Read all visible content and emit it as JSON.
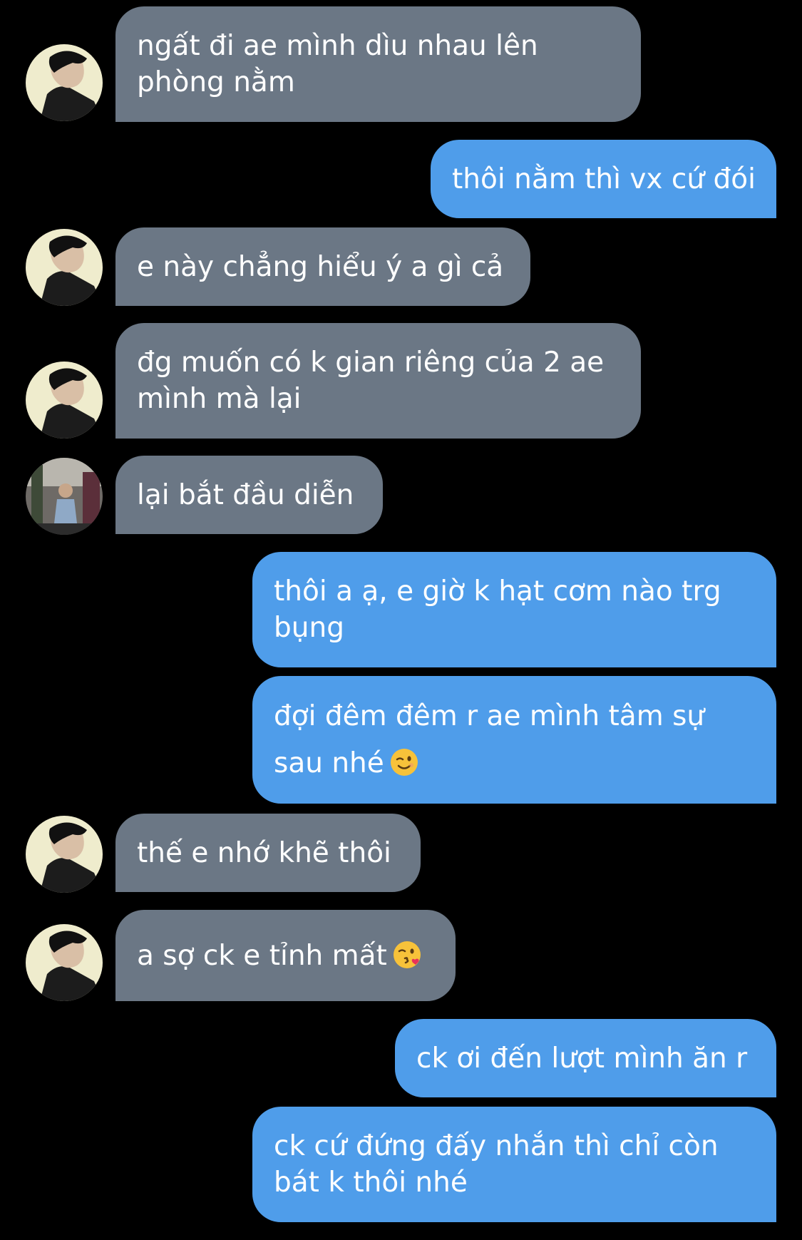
{
  "conversation": {
    "messages": [
      {
        "sender": "other",
        "avatar": "profile-avatar-man",
        "lines": [
          "ngất đi ae mình dìu nhau lên",
          "phòng nằm"
        ]
      },
      {
        "sender": "me",
        "lines": [
          "thôi nằm thì vx cứ đói"
        ]
      },
      {
        "sender": "other",
        "avatar": "profile-avatar-man",
        "lines": [
          "e này chẳng hiểu ý a gì cả"
        ]
      },
      {
        "sender": "other",
        "avatar": "profile-avatar-man",
        "lines": [
          "đg muốn có k gian riêng của 2 ae",
          "mình mà lại"
        ]
      },
      {
        "sender": "other",
        "avatar": "profile-avatar-outdoor-photo",
        "lines": [
          "lại bắt đầu diễn"
        ]
      },
      {
        "sender": "me",
        "lines": [
          "thôi a ạ, e giờ k hạt cơm nào trg",
          "bụng"
        ]
      },
      {
        "sender": "me",
        "lines": [
          "đợi đêm đêm r ae mình tâm sự",
          "sau nhé"
        ],
        "emoji": "winking-face-emoji"
      },
      {
        "sender": "other",
        "avatar": "profile-avatar-man",
        "lines": [
          "thế e nhớ khẽ thôi"
        ]
      },
      {
        "sender": "other",
        "avatar": "profile-avatar-man",
        "lines": [
          "a sợ ck e tỉnh mất"
        ],
        "emoji": "face-blowing-kiss-emoji"
      },
      {
        "sender": "me",
        "lines": [
          "ck ơi đến lượt mình ăn r"
        ]
      },
      {
        "sender": "me",
        "lines": [
          "ck cứ đứng đấy nhắn thì chỉ còn",
          "bát k thôi nhé"
        ]
      }
    ]
  },
  "colors": {
    "background": "#000000",
    "incoming_bubble": "#6b7785",
    "outgoing_bubble": "#4f9dea",
    "text": "#ffffff"
  }
}
